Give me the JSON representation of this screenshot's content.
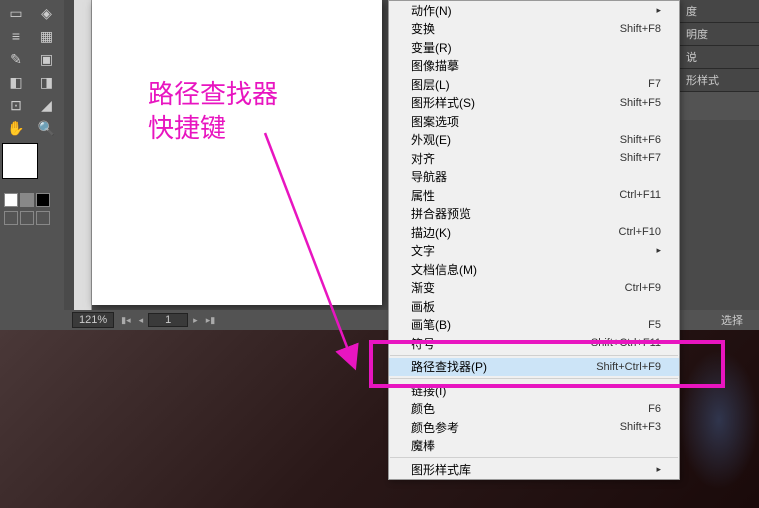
{
  "annotation": {
    "line1": "路径查找器",
    "line2": "快捷键"
  },
  "status": {
    "zoom": "121%",
    "page": "1",
    "selection_label": "选择"
  },
  "panels": {
    "p1": "度",
    "p2": "明度",
    "p3": "说",
    "p4": "形样式"
  },
  "menu": [
    {
      "label": "动作(N)",
      "shortcut": "",
      "sub": true
    },
    {
      "label": "变换",
      "shortcut": "Shift+F8"
    },
    {
      "label": "变量(R)",
      "shortcut": ""
    },
    {
      "label": "图像描摹",
      "shortcut": ""
    },
    {
      "label": "图层(L)",
      "shortcut": "F7"
    },
    {
      "label": "图形样式(S)",
      "shortcut": "Shift+F5"
    },
    {
      "label": "图案选项",
      "shortcut": ""
    },
    {
      "label": "外观(E)",
      "shortcut": "Shift+F6"
    },
    {
      "label": "对齐",
      "shortcut": "Shift+F7"
    },
    {
      "label": "导航器",
      "shortcut": ""
    },
    {
      "label": "属性",
      "shortcut": "Ctrl+F11"
    },
    {
      "label": "拼合器预览",
      "shortcut": ""
    },
    {
      "label": "描边(K)",
      "shortcut": "Ctrl+F10"
    },
    {
      "label": "文字",
      "shortcut": "",
      "sub": true
    },
    {
      "label": "文档信息(M)",
      "shortcut": ""
    },
    {
      "label": "渐变",
      "shortcut": "Ctrl+F9"
    },
    {
      "label": "画板",
      "shortcut": ""
    },
    {
      "label": "画笔(B)",
      "shortcut": "F5"
    },
    {
      "label": "符号",
      "shortcut": "Shift+Ctrl+F11"
    },
    {
      "sep": true
    },
    {
      "label": "路径查找器(P)",
      "shortcut": "Shift+Ctrl+F9",
      "selected": true
    },
    {
      "sep": true
    },
    {
      "label": "链接(I)",
      "shortcut": ""
    },
    {
      "label": "颜色",
      "shortcut": "F6"
    },
    {
      "label": "颜色参考",
      "shortcut": "Shift+F3"
    },
    {
      "label": "魔棒",
      "shortcut": ""
    },
    {
      "sep": true
    },
    {
      "label": "图形样式库",
      "shortcut": "",
      "sub": true
    }
  ],
  "tools": [
    "select",
    "direct",
    "magic",
    "lasso",
    "pen",
    "type",
    "line",
    "rect",
    "brush",
    "pencil",
    "blob",
    "eraser",
    "rotate",
    "scale",
    "width",
    "warp",
    "shape",
    "grad",
    "ed",
    "mesh",
    "ai",
    "graph",
    "ab",
    "slice",
    "hand",
    "zoom"
  ]
}
